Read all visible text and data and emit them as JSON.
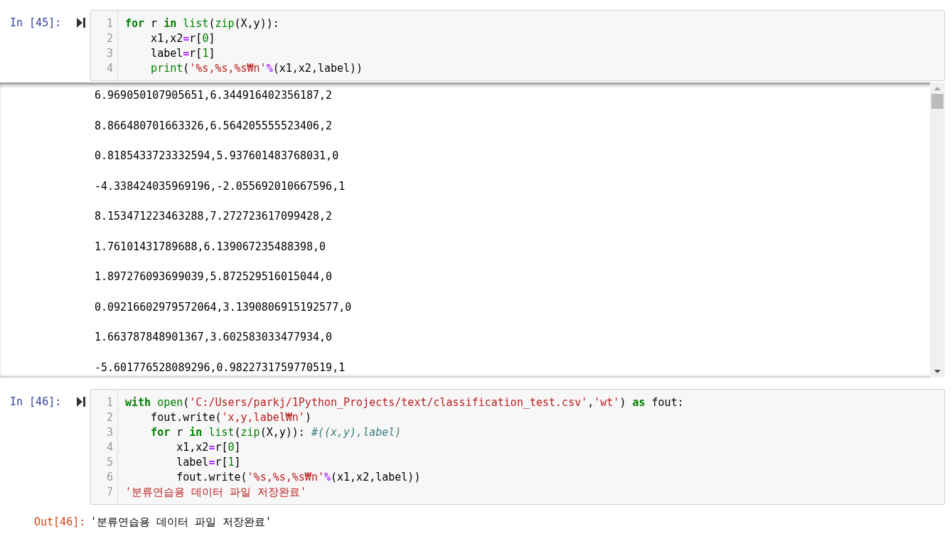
{
  "cells": [
    {
      "prompt": "In [45]:",
      "code_lines": [
        [
          {
            "kind": "keyword",
            "text": "for"
          },
          {
            "kind": "plain",
            "text": " r "
          },
          {
            "kind": "keyword",
            "text": "in"
          },
          {
            "kind": "builtin",
            "text": " list"
          },
          {
            "kind": "plain",
            "text": "("
          },
          {
            "kind": "builtin",
            "text": "zip"
          },
          {
            "kind": "plain",
            "text": "(X,y)):"
          }
        ],
        [
          {
            "kind": "plain",
            "text": "    x1,x2"
          },
          {
            "kind": "operator",
            "text": "="
          },
          {
            "kind": "plain",
            "text": "r["
          },
          {
            "kind": "number",
            "text": "0"
          },
          {
            "kind": "plain",
            "text": "]"
          }
        ],
        [
          {
            "kind": "plain",
            "text": "    label"
          },
          {
            "kind": "operator",
            "text": "="
          },
          {
            "kind": "plain",
            "text": "r["
          },
          {
            "kind": "number",
            "text": "1"
          },
          {
            "kind": "plain",
            "text": "]"
          }
        ],
        [
          {
            "kind": "builtin",
            "text": "    print"
          },
          {
            "kind": "plain",
            "text": "("
          },
          {
            "kind": "string",
            "text": "'%s,%s,%s₩n'"
          },
          {
            "kind": "operator",
            "text": "%"
          },
          {
            "kind": "plain",
            "text": "(x1,x2,label))"
          }
        ]
      ],
      "line_numbers": [
        "1",
        "2",
        "3",
        "4"
      ],
      "output": {
        "kind": "stream",
        "lines": [
          "6.969050107905651,6.344916402356187,2",
          "8.866480701663326,6.564205555523406,2",
          "0.8185433723332594,5.937601483768031,0",
          "-4.338424035969196,-2.055692010667596,1",
          "8.153471223463288,7.272723617099428,2",
          "1.76101431789688,6.139067235488398,0",
          "1.897276093699039,5.872529516015044,0",
          "0.09216602979572064,3.1390806915192577,0",
          "1.663787848901367,3.602583033477934,0",
          "-5.601776528089296,0.9822731759770519,1"
        ]
      }
    },
    {
      "prompt": "In [46]:",
      "code_lines": [
        [
          {
            "kind": "keyword",
            "text": "with"
          },
          {
            "kind": "builtin",
            "text": " open"
          },
          {
            "kind": "plain",
            "text": "("
          },
          {
            "kind": "string",
            "text": "'C:/Users/parkj/1Python_Projects/text/classification_test.csv'"
          },
          {
            "kind": "plain",
            "text": ","
          },
          {
            "kind": "string",
            "text": "'wt'"
          },
          {
            "kind": "plain",
            "text": ") "
          },
          {
            "kind": "keyword",
            "text": "as"
          },
          {
            "kind": "plain",
            "text": " fout:"
          }
        ],
        [
          {
            "kind": "plain",
            "text": "    fout.write("
          },
          {
            "kind": "string",
            "text": "'x,y,label₩n'"
          },
          {
            "kind": "plain",
            "text": ")"
          }
        ],
        [
          {
            "kind": "keyword",
            "text": "    for"
          },
          {
            "kind": "plain",
            "text": " r "
          },
          {
            "kind": "keyword",
            "text": "in"
          },
          {
            "kind": "builtin",
            "text": " list"
          },
          {
            "kind": "plain",
            "text": "("
          },
          {
            "kind": "builtin",
            "text": "zip"
          },
          {
            "kind": "plain",
            "text": "(X,y)):"
          },
          {
            "kind": "comment",
            "text": " #((x,y),label)"
          }
        ],
        [
          {
            "kind": "plain",
            "text": "        x1,x2"
          },
          {
            "kind": "operator",
            "text": "="
          },
          {
            "kind": "plain",
            "text": "r["
          },
          {
            "kind": "number",
            "text": "0"
          },
          {
            "kind": "plain",
            "text": "]"
          }
        ],
        [
          {
            "kind": "plain",
            "text": "        label"
          },
          {
            "kind": "operator",
            "text": "="
          },
          {
            "kind": "plain",
            "text": "r["
          },
          {
            "kind": "number",
            "text": "1"
          },
          {
            "kind": "plain",
            "text": "]"
          }
        ],
        [
          {
            "kind": "plain",
            "text": "        fout.write("
          },
          {
            "kind": "string",
            "text": "'%s,%s,%s₩n'"
          },
          {
            "kind": "operator",
            "text": "%"
          },
          {
            "kind": "plain",
            "text": "(x1,x2,label))"
          }
        ],
        [
          {
            "kind": "string",
            "text": "'분류연습용 데이터 파일 저장완료'"
          }
        ]
      ],
      "line_numbers": [
        "1",
        "2",
        "3",
        "4",
        "5",
        "6",
        "7"
      ],
      "output": {
        "kind": "result",
        "prompt": "Out[46]:",
        "lines": [
          "'분류연습용 데이터 파일 저장완료'"
        ]
      }
    }
  ]
}
